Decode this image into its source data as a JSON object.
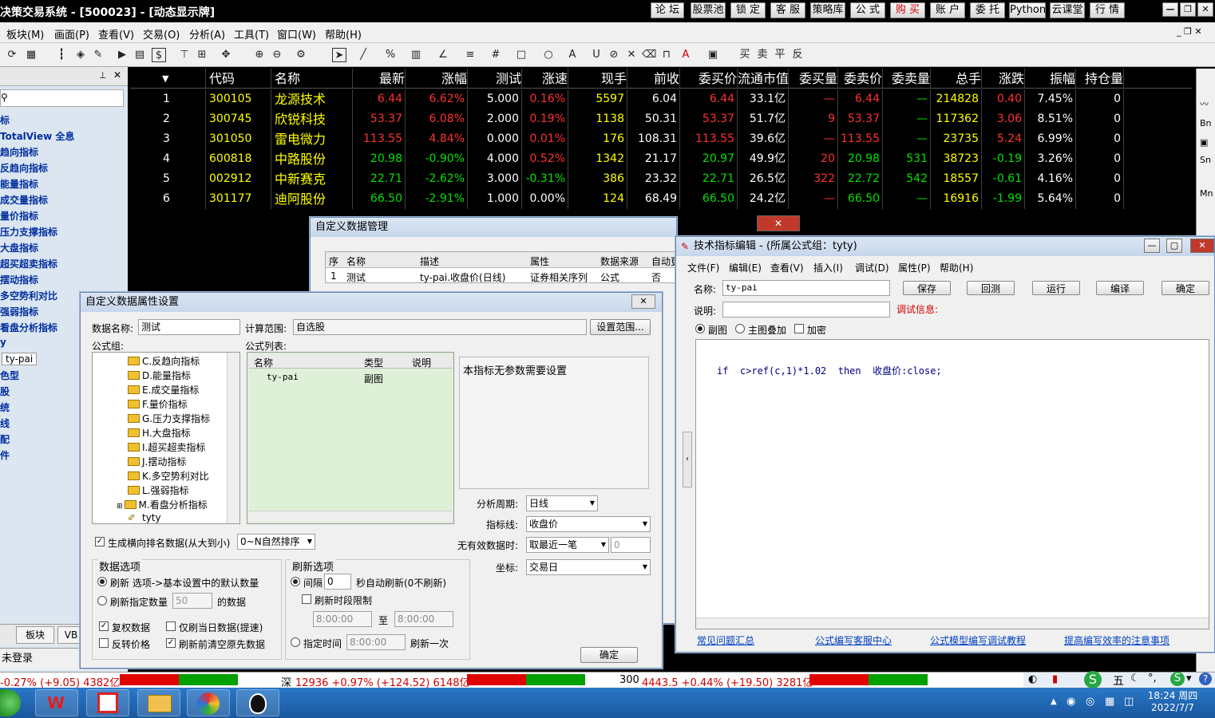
{
  "app": {
    "title": "决策交易系统 - [500023] - [动态显示牌]",
    "top_buttons": [
      "论 坛",
      "股票池",
      "锁 定",
      "客 服",
      "策略库",
      "公 式",
      "购 买",
      "账 户",
      "委 托",
      "Python",
      "云课堂",
      "行 情"
    ]
  },
  "menu": [
    "板块(M)",
    "画面(P)",
    "查看(V)",
    "交易(O)",
    "分析(A)",
    "工具(T)",
    "窗口(W)",
    "帮助(H)"
  ],
  "left_panel": {
    "items": [
      "标",
      "TotalView 全息",
      "趋向指标",
      "反趋向指标",
      "能量指标",
      "成交量指标",
      "量价指标",
      "压力支撑指标",
      "大盘指标",
      "超买超卖指标",
      "摆动指标",
      "多空势利对比",
      "强弱指标",
      "看盘分析指标",
      "y",
      "ty-pai",
      "色型",
      "股",
      "统",
      "线",
      "配",
      "件"
    ],
    "tabs": [
      "板块",
      "VB"
    ],
    "login": "未登录"
  },
  "quote_table": {
    "headers": [
      "",
      "代码",
      "名称",
      "最新",
      "涨幅",
      "测试",
      "涨速",
      "现手",
      "前收",
      "委买价",
      "流通市值",
      "委买量",
      "委卖价",
      "委卖量",
      "总手",
      "涨跌",
      "振幅",
      "持仓量"
    ],
    "rows": [
      [
        "1",
        "300105",
        "龙源技术",
        "6.44",
        "6.62%",
        "5.000",
        "0.16%",
        "5597",
        "6.04",
        "6.44",
        "33.1亿",
        "—",
        "6.44",
        "—",
        "214828",
        "0.40",
        "7.45%",
        "0"
      ],
      [
        "2",
        "300745",
        "欣锐科技",
        "53.37",
        "6.08%",
        "2.000",
        "0.19%",
        "1138",
        "50.31",
        "53.37",
        "51.7亿",
        "9",
        "53.37",
        "—",
        "117362",
        "3.06",
        "8.51%",
        "0"
      ],
      [
        "3",
        "301050",
        "雷电微力",
        "113.55",
        "4.84%",
        "0.000",
        "0.01%",
        "176",
        "108.31",
        "113.55",
        "39.6亿",
        "—",
        "113.55",
        "—",
        "23735",
        "5.24",
        "6.99%",
        "0"
      ],
      [
        "4",
        "600818",
        "中路股份",
        "20.98",
        "-0.90%",
        "4.000",
        "0.52%",
        "1342",
        "21.17",
        "20.97",
        "49.9亿",
        "20",
        "20.98",
        "531",
        "38723",
        "-0.19",
        "3.26%",
        "0"
      ],
      [
        "5",
        "002912",
        "中新赛克",
        "22.71",
        "-2.62%",
        "3.000",
        "-0.31%",
        "386",
        "23.32",
        "22.71",
        "26.5亿",
        "322",
        "22.72",
        "542",
        "18557",
        "-0.61",
        "4.16%",
        "0"
      ],
      [
        "6",
        "301177",
        "迪阿股份",
        "66.50",
        "-2.91%",
        "1.000",
        "0.00%",
        "124",
        "68.49",
        "66.50",
        "24.2亿",
        "—",
        "66.50",
        "—",
        "16916",
        "-1.99",
        "5.64%",
        "0"
      ]
    ]
  },
  "custom_data_mgr": {
    "title": "自定义数据管理",
    "headers": [
      "序",
      "名称",
      "描述",
      "属性",
      "数据来源",
      "自动更"
    ],
    "row": [
      "1",
      "测试",
      "ty-pai.收盘价(日线)",
      "证券相关序列",
      "公式",
      "否"
    ]
  },
  "props_dialog": {
    "title": "自定义数据属性设置",
    "name_label": "数据名称:",
    "name_value": "测试",
    "range_label": "计算范围:",
    "range_value": "自选股",
    "range_btn": "设置范围...",
    "group_label": "公式组:",
    "list_label": "公式列表:",
    "tree": [
      "C.反趋向指标",
      "D.能量指标",
      "E.成交量指标",
      "F.量价指标",
      "G.压力支撑指标",
      "H.大盘指标",
      "I.超买超卖指标",
      "J.摆动指标",
      "K.多空势利对比",
      "L.强弱指标",
      "M.看盘分析指标",
      "tyty"
    ],
    "list_headers": [
      "名称",
      "类型",
      "说明"
    ],
    "list_row": [
      "ty-pai",
      "副图",
      ""
    ],
    "param_note": "本指标无参数需要设置",
    "period_label": "分析周期:",
    "period_value": "日线",
    "line_label": "指标线:",
    "line_value": "收盘价",
    "invalid_label": "无有效数据时:",
    "invalid_value": "取最近一笔",
    "invalid_num": "0",
    "coord_label": "坐标:",
    "coord_value": "交易日",
    "rank_label": "生成横向排名数据(从大到小)",
    "rank_value": "0~N自然排序",
    "data_opts_title": "数据选项",
    "refresh_default": "刷新 选项->基本设置中的默认数量",
    "refresh_count": "刷新指定数量",
    "refresh_count_value": "50",
    "refresh_count_suffix": "的数据",
    "fuquan": "复权数据",
    "only_today": "仅刷当日数据(提速)",
    "reverse": "反转价格",
    "clear_before": "刷新前清空原先数据",
    "refresh_opts_title": "刷新选项",
    "interval": "间隔",
    "interval_value": "0",
    "interval_suffix": "秒自动刷新(0不刷新)",
    "time_limit": "刷新时段限制",
    "time_from": "8:00:00",
    "time_to_label": "至",
    "time_to": "8:00:00",
    "specified": "指定时间",
    "specified_value": "8:00:00",
    "specified_suffix": "刷新一次",
    "ok": "确定"
  },
  "editor": {
    "title": "技术指标编辑 - (所属公式组：tyty)",
    "menu": [
      "文件(F)",
      "编辑(E)",
      "查看(V)",
      "插入(I)",
      "调试(D)",
      "属性(P)",
      "帮助(H)"
    ],
    "name_label": "名称:",
    "name_value": "ty-pai",
    "desc_label": "说明:",
    "debug_label": "调试信息:",
    "buttons": [
      "保存",
      "回测",
      "运行",
      "编译",
      "确定"
    ],
    "radio_sub": "副图",
    "radio_main": "主图叠加",
    "encrypt": "加密",
    "code": "if  c>ref(c,1)*1.02  then  收盘价:close;",
    "links": [
      "常见问题汇总",
      "公式编写客服中心",
      "公式模型编写调试教程",
      "提高编写效率的注意事项"
    ]
  },
  "status": {
    "sh": "-0.27% (+9.05) 4382亿",
    "sz_label": "深",
    "sz": "12936 +0.97% (+124.52) 6148亿",
    "cy_label": "300",
    "cy": "4443.5 +0.44% (+19.50) 3281亿"
  },
  "clock": {
    "time": "18:24 周四",
    "date": "2022/7/7"
  },
  "colors": {
    "up": "#ff3030",
    "down": "#00e000",
    "code": "#ffff00",
    "accent": "#2a78c8"
  }
}
